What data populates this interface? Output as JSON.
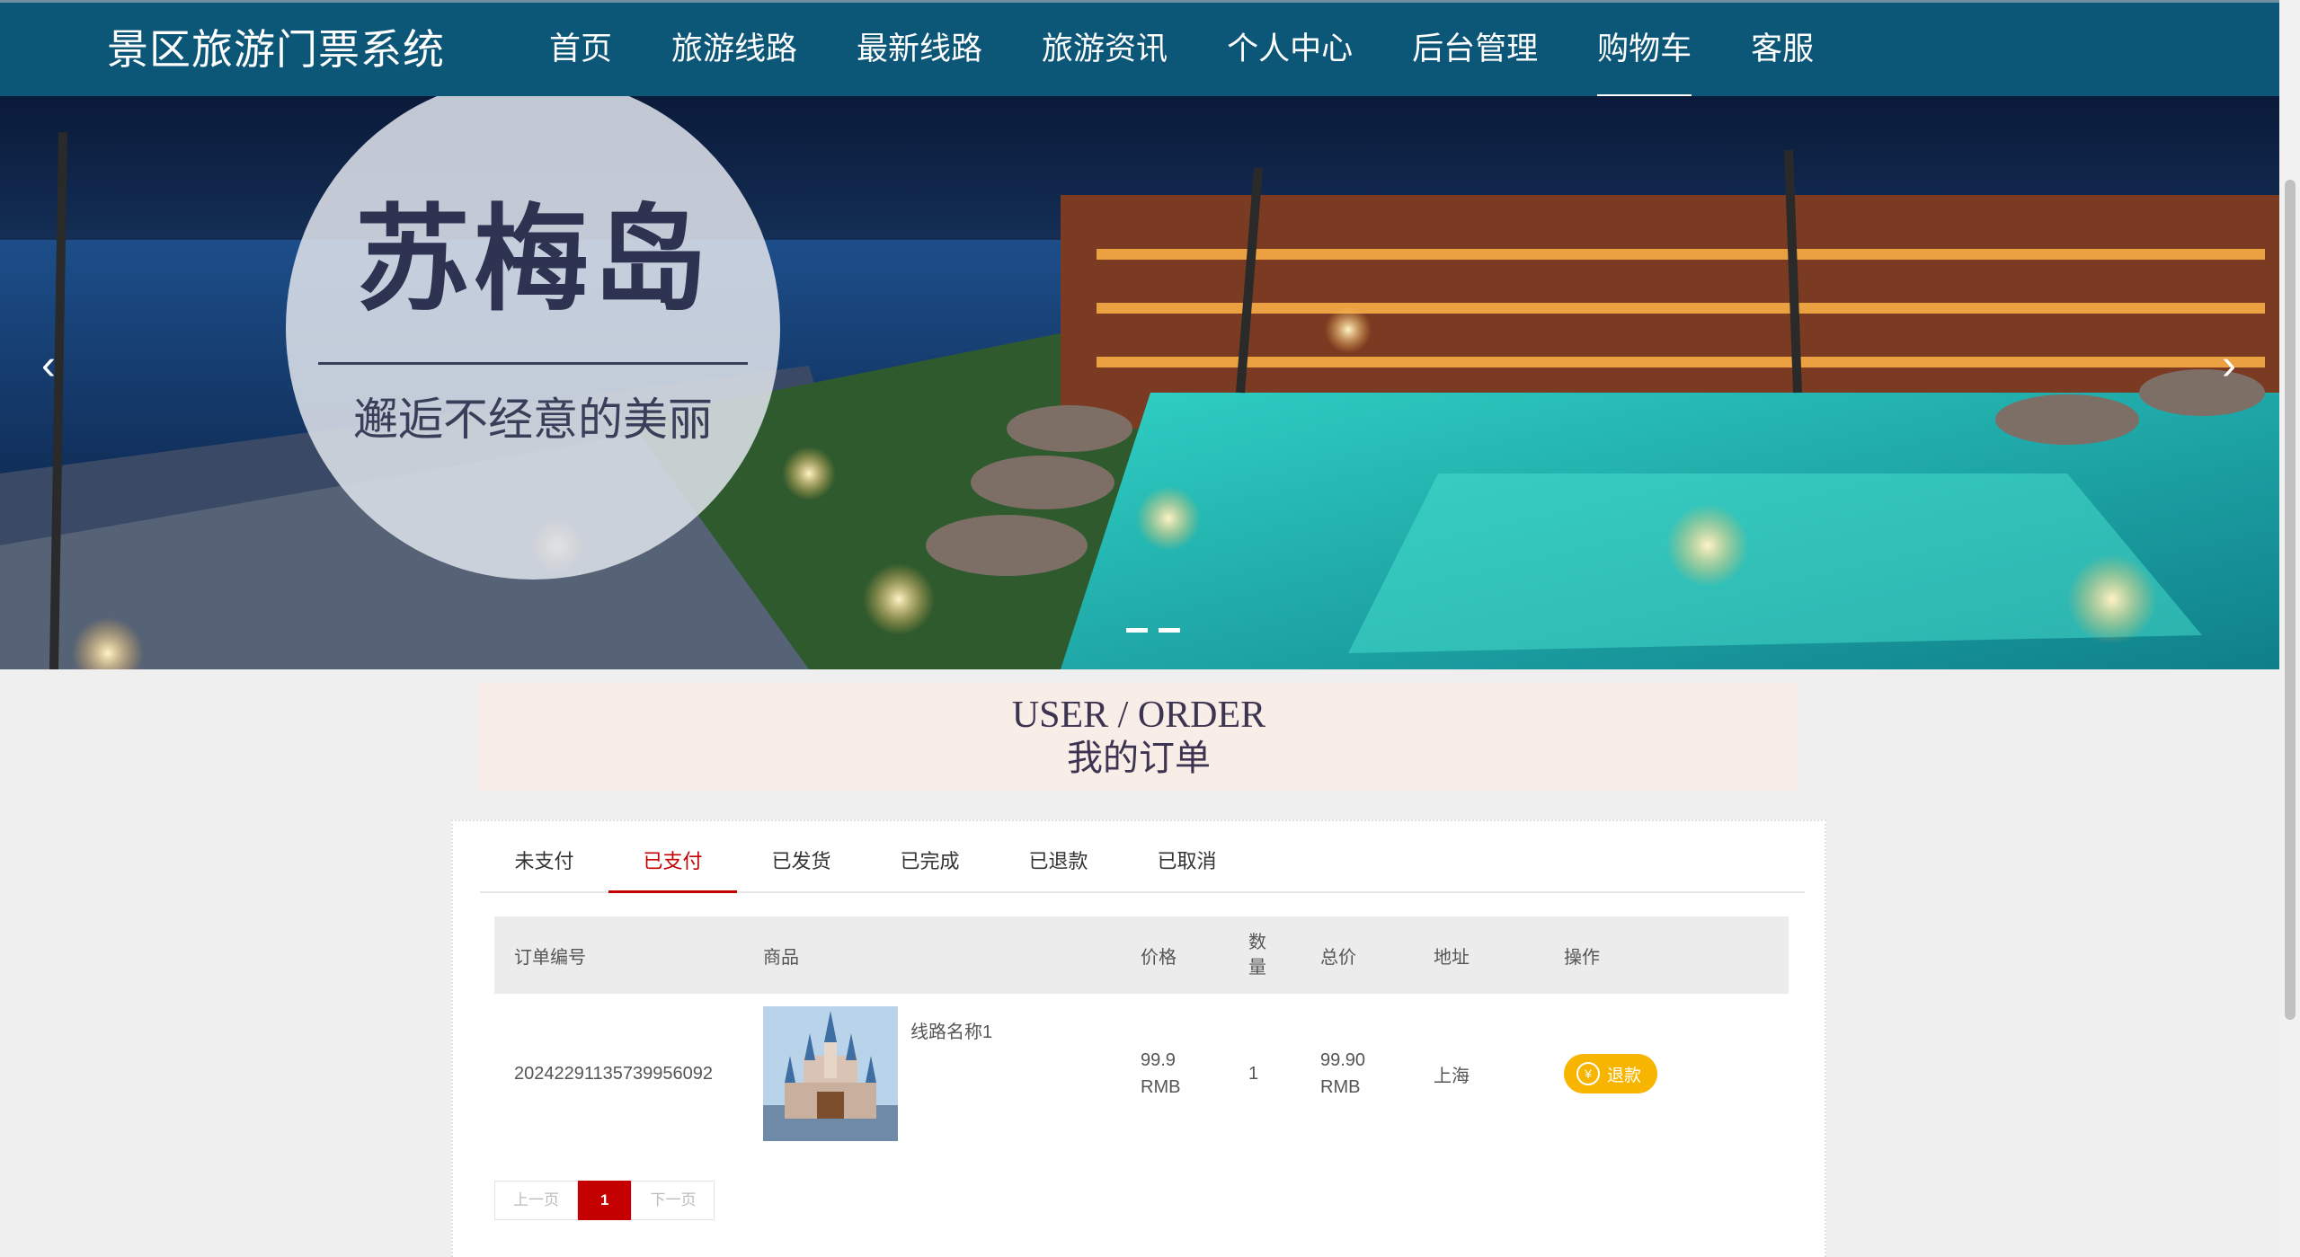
{
  "header": {
    "brand": "景区旅游门票系统",
    "nav": [
      {
        "label": "首页",
        "active": false
      },
      {
        "label": "旅游线路",
        "active": false
      },
      {
        "label": "最新线路",
        "active": false
      },
      {
        "label": "旅游资讯",
        "active": false
      },
      {
        "label": "个人中心",
        "active": false
      },
      {
        "label": "后台管理",
        "active": false
      },
      {
        "label": "购物车",
        "active": true
      },
      {
        "label": "客服",
        "active": false
      }
    ]
  },
  "banner": {
    "title": "苏梅岛",
    "subtitle": "邂逅不经意的美丽",
    "prev_icon": "chevron-left-icon",
    "next_icon": "chevron-right-icon",
    "slides": 2
  },
  "section": {
    "title_en": "USER / ORDER",
    "title_cn": "我的订单"
  },
  "tabs": [
    {
      "label": "未支付",
      "active": false
    },
    {
      "label": "已支付",
      "active": true
    },
    {
      "label": "已发货",
      "active": false
    },
    {
      "label": "已完成",
      "active": false
    },
    {
      "label": "已退款",
      "active": false
    },
    {
      "label": "已取消",
      "active": false
    }
  ],
  "table": {
    "headers": {
      "order_no": "订单编号",
      "product": "商品",
      "price": "价格",
      "qty_line1": "数",
      "qty_line2": "量",
      "total": "总价",
      "address": "地址",
      "action": "操作"
    },
    "rows": [
      {
        "order_no": "20242291135739956092",
        "product_name": "线路名称1",
        "price": "99.9",
        "price_unit": "RMB",
        "qty": "1",
        "total": "99.90",
        "total_unit": "RMB",
        "address": "上海",
        "action_label": "退款",
        "action_icon": "yen-icon"
      }
    ]
  },
  "pagination": {
    "prev": "上一页",
    "current": "1",
    "next": "下一页"
  },
  "colors": {
    "header_bg": "#0c5677",
    "accent_red": "#c40000",
    "refund_btn": "#f7b500",
    "title_bg": "#f9ede7"
  }
}
